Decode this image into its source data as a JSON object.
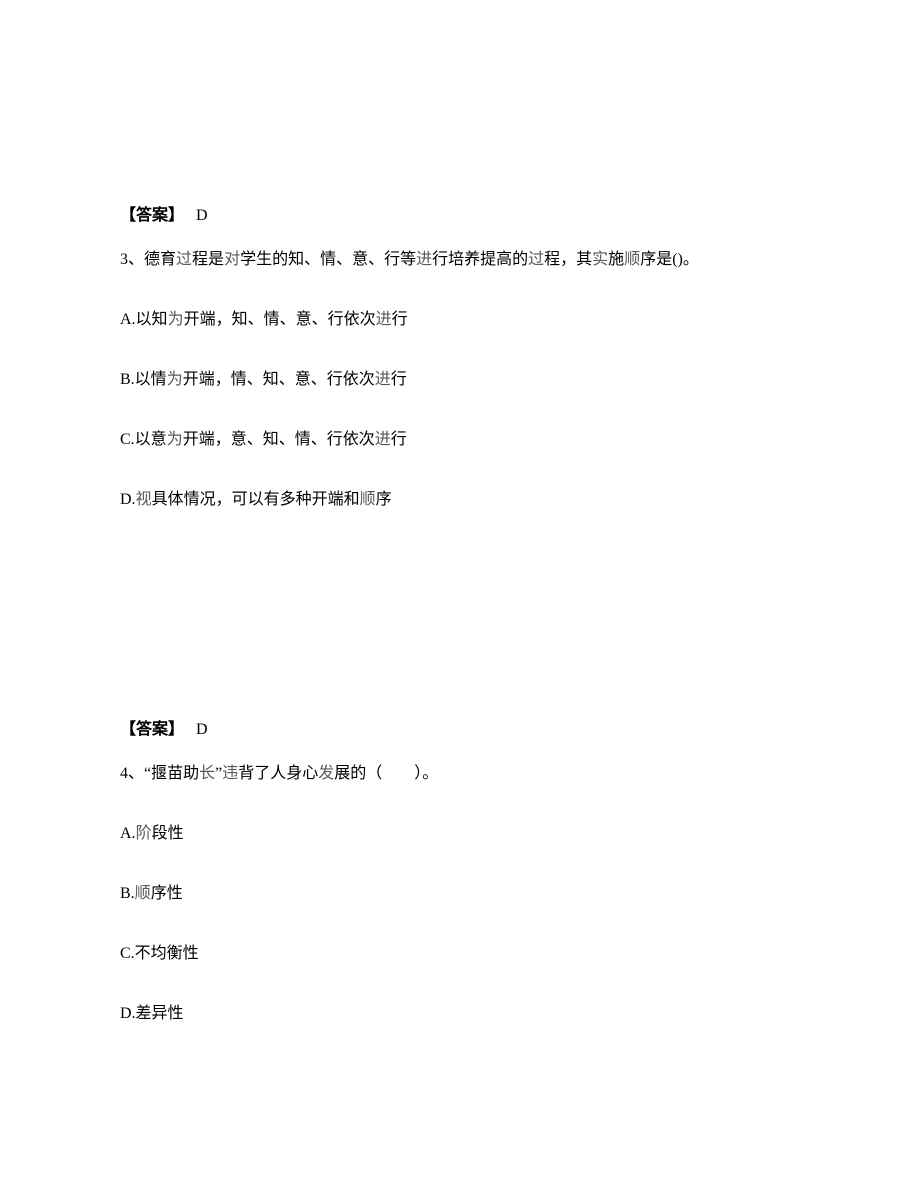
{
  "answer2": {
    "label": "【答案】",
    "value": "D"
  },
  "q3": {
    "number": "3、",
    "stem_part1": "德育",
    "stem_part2": "过",
    "stem_part3": "程是",
    "stem_part4": "对",
    "stem_part5": "学生的知、情、意、行等",
    "stem_part6": "进",
    "stem_part7": "行培养提高的",
    "stem_part8": "过",
    "stem_part9": "程，其",
    "stem_part10": "实",
    "stem_part11": "施",
    "stem_part12": "顺",
    "stem_part13": "序是()。",
    "optA_p1": "A.以知",
    "optA_p2": "为",
    "optA_p3": "开端，知、情、意、行依次",
    "optA_p4": "进",
    "optA_p5": "行",
    "optB_p1": "B.以情",
    "optB_p2": "为",
    "optB_p3": "开端，情、知、意、行依次",
    "optB_p4": "进",
    "optB_p5": "行",
    "optC_p1": "C.以意",
    "optC_p2": "为",
    "optC_p3": "开端，意、知、情、行依次",
    "optC_p4": "进",
    "optC_p5": "行",
    "optD_p1": "D.",
    "optD_p2": "视",
    "optD_p3": "具体情况，可以有多种开端和",
    "optD_p4": "顺",
    "optD_p5": "序"
  },
  "answer3": {
    "label": "【答案】",
    "value": "D"
  },
  "q4": {
    "number": "4、",
    "stem_part1": "“揠苗助",
    "stem_part2": "长",
    "stem_part3": "”",
    "stem_part4": "违",
    "stem_part5": "背了人身心",
    "stem_part6": "发",
    "stem_part7": "展的（　　）。",
    "optA_p1": "A.",
    "optA_p2": "阶",
    "optA_p3": "段性",
    "optB_p1": "B.",
    "optB_p2": "顺",
    "optB_p3": "序性",
    "optC": "C.不均衡性",
    "optD": "D.差异性"
  }
}
